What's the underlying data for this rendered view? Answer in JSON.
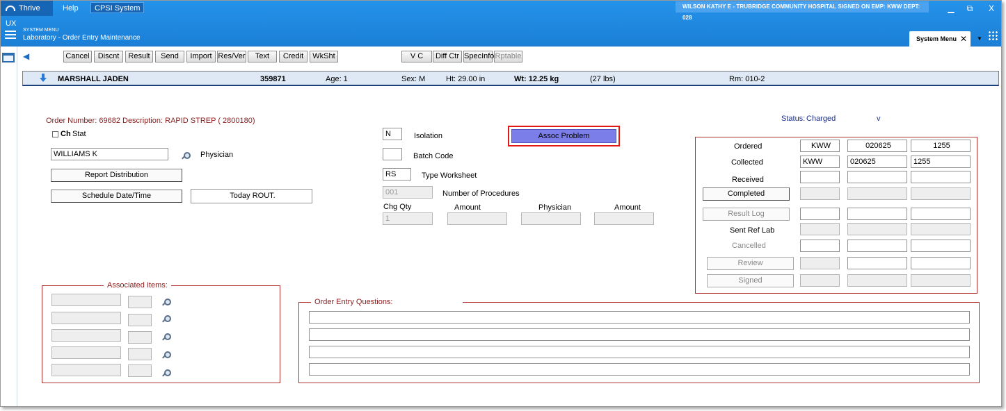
{
  "topbar": {
    "app_name": "Thrive UX",
    "help": "Help",
    "system": "CPSI System",
    "user_info": "WILSON KATHY E - TRUBRIDGE COMMUNITY HOSPITAL   SIGNED ON EMP: KWW   DEPT: 028",
    "minimize": "▁",
    "restore": "⧉",
    "close": "X",
    "menu_small": "SYSTEM MENU",
    "menu_title": "Laboratory - Order Entry Maintenance",
    "system_menu_tab": "System Menu",
    "system_menu_close": "✕",
    "dropdown": "▼"
  },
  "toolbar": {
    "back": "◀",
    "buttons": [
      "Cancel",
      "Discnt",
      "Result",
      "Send",
      "Import",
      "Res/Ver",
      "Text",
      "Credit",
      "WkSht",
      "V C",
      "Diff Ctr",
      "SpecInfo",
      "Rptable"
    ]
  },
  "patient": {
    "name": "MARSHALL JADEN",
    "id": "359871",
    "age": "Age: 1",
    "sex": "Sex: M",
    "height": "Ht: 29.00 in",
    "weight": "Wt: 12.25 kg",
    "weight_lbs": "(27 lbs)",
    "room": "Rm: 010-2"
  },
  "order": {
    "number": "Order Number: 69682",
    "description": "Description: RAPID STREP  ( 2800180)",
    "status_label": "Status:",
    "status_value": "Charged",
    "status_dd": "v",
    "ch": "Ch",
    "stat": "Stat",
    "physician_value": "WILLIAMS K",
    "physician_label": "Physician",
    "report_distribution": "Report   Distribution",
    "schedule": "Schedule Date/Time",
    "today": "Today    ROUT.",
    "isolation_value": "N",
    "isolation_label": "Isolation",
    "batch_value": "",
    "batch_label": "Batch Code",
    "worksheet_value": "RS",
    "worksheet_label": "Type Worksheet",
    "procedures_value": "001",
    "procedures_label": "Number of Procedures",
    "chg_qty_label": "Chg Qty",
    "chg_qty_value": "1",
    "amount_label": "Amount",
    "physician_col_label": "Physician",
    "amount2_label": "Amount",
    "assoc_problem": "Assoc Problem"
  },
  "tracking": {
    "ordered_label": "Ordered",
    "ordered": [
      "KWW",
      "020625",
      "1255"
    ],
    "collected_label": "Collected",
    "collected": [
      "KWW",
      "020625",
      "1255"
    ],
    "received_label": "Received",
    "completed_label": "Completed",
    "result_log_label": "Result Log",
    "sent_ref_lab_label": "Sent Ref Lab",
    "cancelled_label": "Cancelled",
    "review_label": "Review",
    "signed_label": "Signed"
  },
  "associated_items": {
    "title": "Associated Items:"
  },
  "questions": {
    "title": "Order Entry Questions:"
  }
}
